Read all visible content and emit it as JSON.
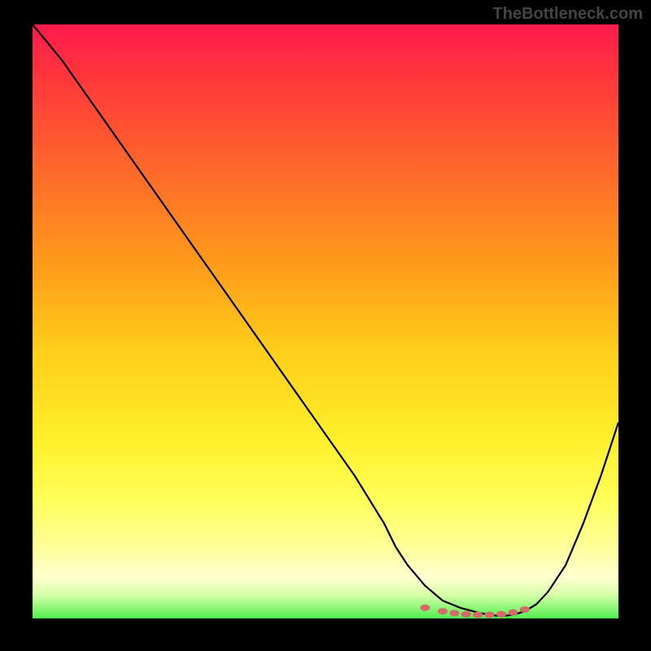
{
  "watermark": "TheBottleneck.com",
  "colors": {
    "background": "#000000",
    "curve_stroke": "#000000",
    "marker_fill": "#d46a6a",
    "gradient_top": "#ff1a4d",
    "gradient_bottom": "#50ef50"
  },
  "chart_data": {
    "type": "line",
    "title": "",
    "xlabel": "",
    "ylabel": "",
    "xlim": [
      0,
      100
    ],
    "ylim": [
      0,
      100
    ],
    "series": [
      {
        "name": "bottleneck-curve",
        "x_pct": [
          0,
          5,
          10,
          15,
          20,
          25,
          30,
          35,
          40,
          45,
          50,
          55,
          60,
          62,
          64,
          67,
          70,
          73,
          76,
          78,
          80,
          82,
          84,
          86,
          88,
          91,
          94,
          97,
          100
        ],
        "y_pct": [
          100,
          94,
          87,
          80,
          73,
          66,
          59,
          52,
          45,
          38,
          31,
          24,
          16,
          12,
          9,
          5.5,
          3,
          1.8,
          1.0,
          0.6,
          0.4,
          0.6,
          1.2,
          2.4,
          4.5,
          9,
          16,
          24,
          33
        ]
      }
    ],
    "markers": {
      "name": "near-zero-markers",
      "x_pct": [
        67,
        70,
        72,
        74,
        76,
        78,
        80,
        82,
        84
      ],
      "y_pct": [
        1.8,
        1.2,
        0.9,
        0.7,
        0.6,
        0.6,
        0.7,
        1.0,
        1.5
      ]
    }
  }
}
